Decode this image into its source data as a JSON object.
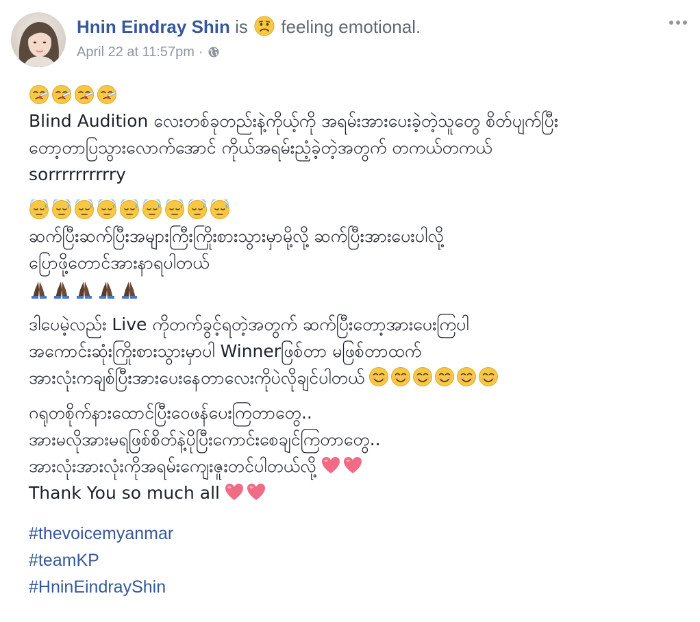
{
  "header": {
    "author_name": "Hnin Eindray Shin",
    "is_text": "is",
    "feeling_text": "feeling emotional.",
    "timestamp": "April 22 at 11:57pm",
    "separator": "·"
  },
  "emoji_names": {
    "row1": "face-with-thermometer-icon",
    "row2": "downcast-sweat-face-icon",
    "row3": "folded-hands-icon",
    "smile": "smiling-face-icon",
    "heart": "heart-icon"
  },
  "body": {
    "p1": [
      "Blind Audition လေးတစ်ခုတည်းနဲ့ကိုယ့်ကို အရမ်းအားပေးခဲ့တဲ့သူတွေ စိတ်ပျက်ပြီး",
      "တော့တာပြသွားလောက်အောင် ကိုယ်အရမ်းညံ့ခဲ့တဲ့အတွက် တကယ်တကယ်",
      "sorrrrrrrrrry"
    ],
    "p2": [
      "ဆက်ပြီးဆက်ပြီးအများကြီးကြိုးစားသွားမှာမို့လို့ ဆက်ပြီးအားပေးပါလို့",
      "ပြောဖို့တောင်အားနာရပါတယ်"
    ],
    "p3": [
      "ဒါပေမဲ့လည်း Live ကိုတက်ခွင့်ရတဲ့အတွက် ဆက်ပြီးတော့အားပေးကြပါ",
      "အကောင်းဆုံးကြိုးစားသွားမှာပါ Winnerဖြစ်တာ မဖြစ်တာထက်",
      "အားလုံးကချစ်ပြီးအားပေးနေတာလေးကိုပဲလိုချင်ပါတယ်"
    ],
    "p4": [
      "ဂရုတစိုက်နားထောင်ပြီးဝေဖန်ပေးကြတာတွေ..",
      "အားမလိုအားမရဖြစ်စိတ်နဲ့ပိုပြီးကောင်းစေချင်ကြတာတွေ..",
      "အားလုံးအားလုံးကိုအရမ်းကျေးဇူးတင်ပါတယ်လို့",
      "Thank You so much all"
    ]
  },
  "hashtags": [
    "#thevoicemyanmar",
    "#teamKP",
    "#HninEindrayShin"
  ],
  "colors": {
    "link": "#365899",
    "meta": "#90949c",
    "text": "#1d2129"
  }
}
